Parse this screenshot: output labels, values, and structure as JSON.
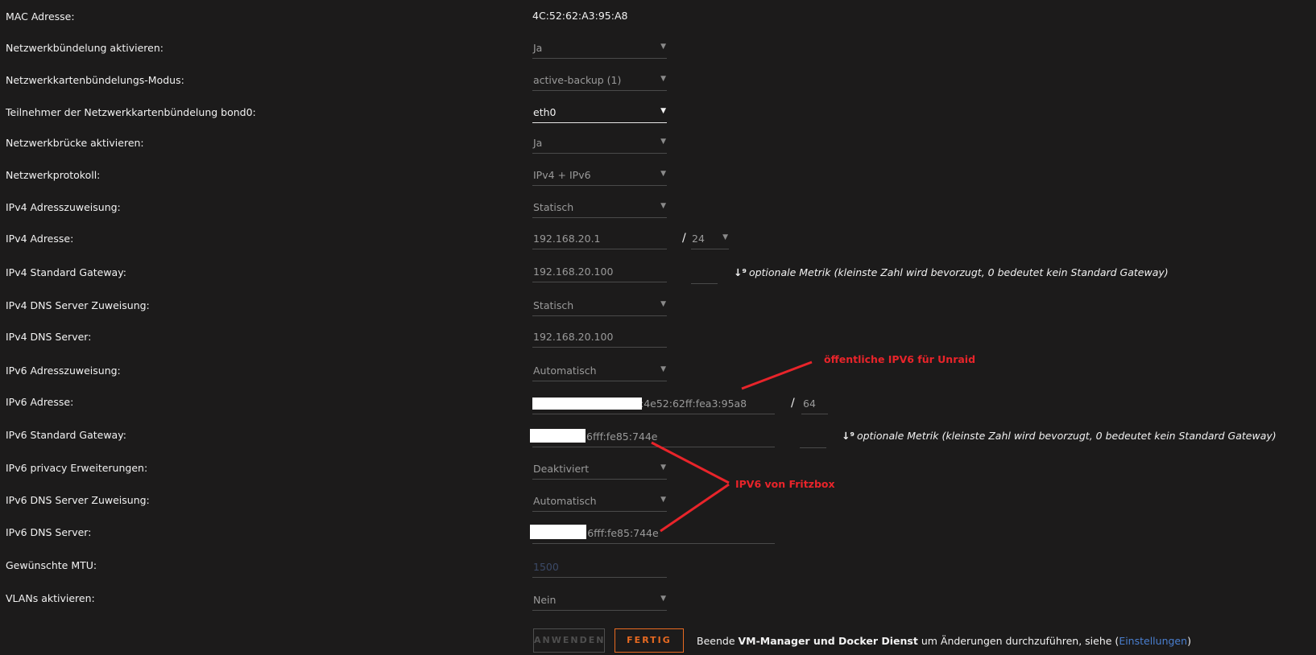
{
  "rows": {
    "mac": {
      "label": "MAC Adresse:",
      "value": "4C:52:62:A3:95:A8"
    },
    "bonding": {
      "label": "Netzwerkbündelung aktivieren:",
      "value": "Ja"
    },
    "bonding_mode": {
      "label": "Netzwerkkartenbündelungs-Modus:",
      "value": "active-backup (1)"
    },
    "bond_members": {
      "label": "Teilnehmer der Netzwerkkartenbündelung bond0:",
      "value": "eth0"
    },
    "bridge": {
      "label": "Netzwerkbrücke aktivieren:",
      "value": "Ja"
    },
    "protocol": {
      "label": "Netzwerkprotokoll:",
      "value": "IPv4 + IPv6"
    },
    "ipv4_assign": {
      "label": "IPv4 Adresszuweisung:",
      "value": "Statisch"
    },
    "ipv4_addr": {
      "label": "IPv4 Adresse:",
      "value": "192.168.20.1",
      "slash": "/",
      "prefix": "24"
    },
    "ipv4_gw": {
      "label": "IPv4 Standard Gateway:",
      "value": "192.168.20.100",
      "metric": "",
      "hint_icon": "↓⁹",
      "hint": "optionale Metrik (kleinste Zahl wird bevorzugt, 0 bedeutet kein Standard Gateway)"
    },
    "ipv4_dns_assign": {
      "label": "IPv4 DNS Server Zuweisung:",
      "value": "Statisch"
    },
    "ipv4_dns": {
      "label": "IPv4 DNS Server:",
      "value": "192.168.20.100"
    },
    "ipv6_assign": {
      "label": "IPv6 Adresszuweisung:",
      "value": "Automatisch"
    },
    "ipv6_addr": {
      "label": "IPv6 Adresse:",
      "value": ":4e52:62ff:fea3:95a8",
      "slash": "/",
      "prefix": "64"
    },
    "ipv6_gw": {
      "label": "IPv6 Standard Gateway:",
      "value": "6fff:fe85:744e",
      "metric": "",
      "hint_icon": "↓⁹",
      "hint": "optionale Metrik (kleinste Zahl wird bevorzugt, 0 bedeutet kein Standard Gateway)"
    },
    "ipv6_privacy": {
      "label": "IPv6 privacy Erweiterungen:",
      "value": "Deaktiviert"
    },
    "ipv6_dns_assign": {
      "label": "IPv6 DNS Server Zuweisung:",
      "value": "Automatisch"
    },
    "ipv6_dns": {
      "label": "IPv6 DNS Server:",
      "value": ":6fff:fe85:744e"
    },
    "mtu": {
      "label": "Gewünschte MTU:",
      "placeholder": "1500"
    },
    "vlans": {
      "label": "VLANs aktivieren:",
      "value": "Nein"
    }
  },
  "annotations": {
    "public_ipv6": "öffentliche IPV6 für Unraid",
    "fritzbox": "IPV6 von Fritzbox",
    "color": "#e8242a"
  },
  "buttons": {
    "apply": "ANWENDEN",
    "done": "FERTIG"
  },
  "note": {
    "prefix": "Beende ",
    "bold": "VM-Manager und Docker Dienst",
    "middle": " um Änderungen durchzuführen, siehe (",
    "link": "Einstellungen",
    "suffix": ")"
  },
  "colors": {
    "background": "#1c1b1b",
    "accent": "#e86a21",
    "link": "#4a7fd0",
    "annotation": "#e8242a"
  },
  "icons": {
    "dropdown": "chevron-down-icon",
    "sort": "sort-numeric-icon"
  }
}
